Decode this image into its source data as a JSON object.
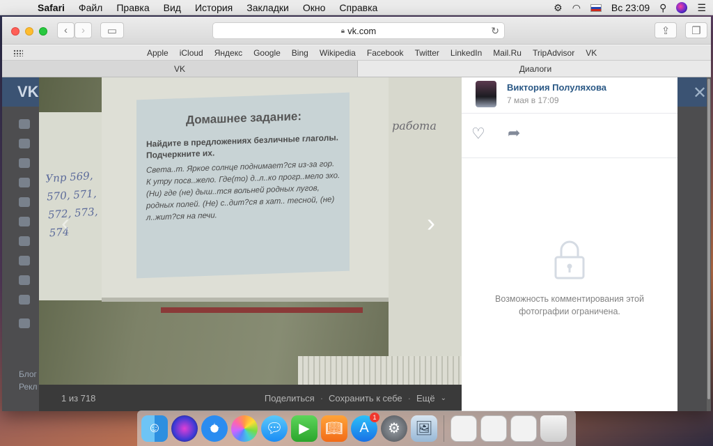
{
  "menubar": {
    "app": "Safari",
    "items": [
      "Файл",
      "Правка",
      "Вид",
      "История",
      "Закладки",
      "Окно",
      "Справка"
    ],
    "clock": "Вс 23:09"
  },
  "browser": {
    "url": "vk.com",
    "favorites": [
      "Apple",
      "iCloud",
      "Яндекс",
      "Google",
      "Bing",
      "Wikipedia",
      "Facebook",
      "Twitter",
      "LinkedIn",
      "Mail.Ru",
      "TripAdvisor",
      "VK"
    ],
    "tabs": [
      "VK",
      "Диалоги"
    ]
  },
  "vk": {
    "sidebar_links": [
      "Блог",
      "Рекл"
    ]
  },
  "photo": {
    "whiteboard_text": "Упр 569,\n570, 571,\n572, 573,\n574",
    "right_wall_text": "работа",
    "slide_title": "Домашнее задание:",
    "slide_bullet": "Найдите в предложениях безличные глаголы. Подчеркните их.",
    "slide_text": "Света..т. Яркое солнце поднимает?ся из-за гор. К утру посв..жело. Где(то) д..л..ко прогр..мело эхо. (Ни) где (не) дыш..тся вольней родных лугов, родных полей. (Не) с..дит?ся в хат.. тесной, (не) л..жит?ся на печи."
  },
  "viewer": {
    "counter": "1 из 718",
    "share": "Поделиться",
    "save": "Сохранить к себе",
    "more": "Ещё",
    "author_name": "Виктория Полуляхова",
    "author_date": "7 мая в 17:09",
    "comments_disabled": "Возможность комментирования этой фотографии ограничена."
  },
  "dock": {
    "icons": [
      "finder-icon",
      "siri-icon",
      "safari-icon",
      "photos-icon",
      "messages-icon",
      "facetime-icon",
      "ibooks-icon",
      "app-store-icon",
      "system-preferences-icon",
      "preview-icon",
      "stack-icon",
      "stack-icon",
      "stack-icon",
      "trash-icon"
    ],
    "app_store_badge": "1"
  }
}
